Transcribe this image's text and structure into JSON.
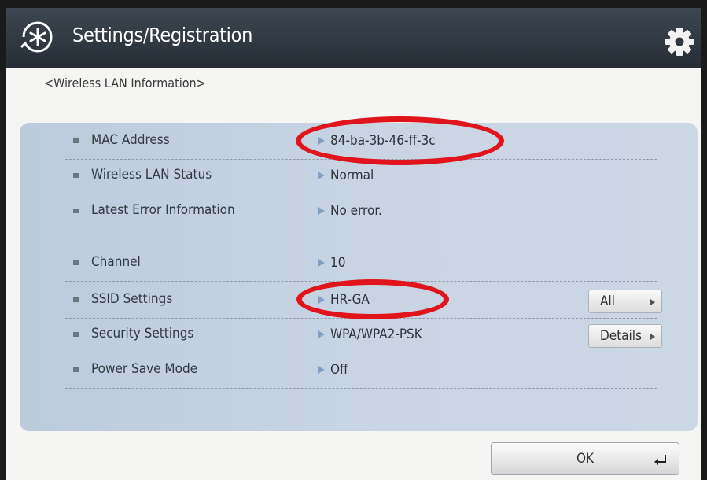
{
  "header": {
    "title": "Settings/Registration"
  },
  "page": {
    "subtitle": "<Wireless LAN Information>"
  },
  "rows": [
    {
      "label": "MAC Address",
      "value": "84-ba-3b-46-ff-3c"
    },
    {
      "label": "Wireless LAN Status",
      "value": "Normal"
    },
    {
      "label": "Latest Error Information",
      "value": "No error."
    },
    {
      "label": "Channel",
      "value": "10"
    },
    {
      "label": "SSID Settings",
      "value": "HR-GA",
      "button": "All"
    },
    {
      "label": "Security Settings",
      "value": "WPA/WPA2-PSK",
      "button": "Details"
    },
    {
      "label": "Power Save Mode",
      "value": "Off"
    }
  ],
  "footer": {
    "ok_label": "OK"
  },
  "icons": {
    "app": "settings-registration-icon",
    "gear": "gear-icon",
    "enter": "enter-icon"
  },
  "colors": {
    "titlebar": "#2f3740",
    "panel": "#c4d1df",
    "annotation": "#e1141c",
    "row_arrow": "#7fa0c4"
  }
}
